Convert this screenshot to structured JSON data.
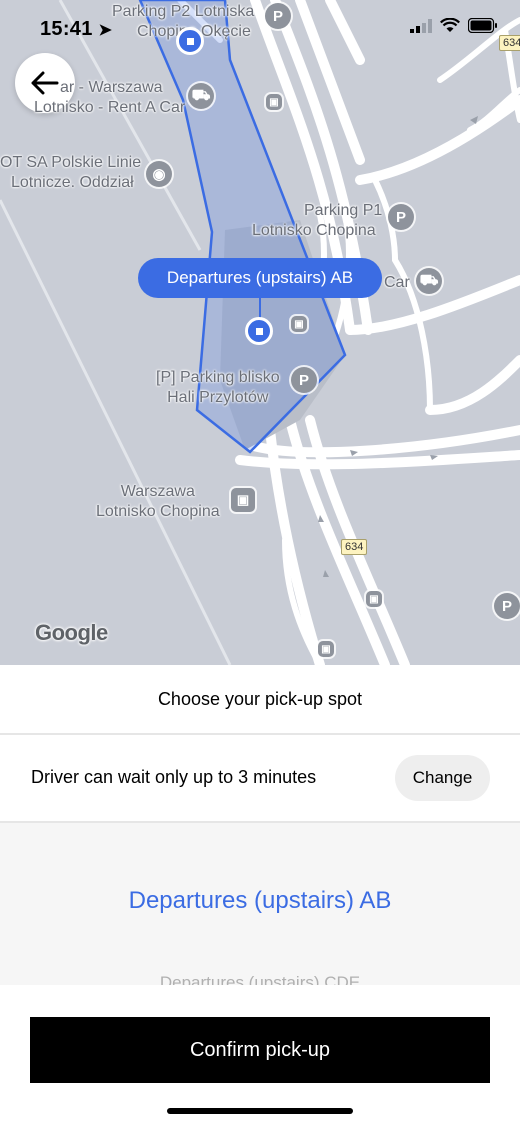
{
  "status_bar": {
    "time": "15:41",
    "location_icon": "location-arrow-icon",
    "signal_icon": "cellular-signal-icon",
    "wifi_icon": "wifi-icon",
    "battery_icon": "battery-icon"
  },
  "map": {
    "back_icon": "arrow-left-icon",
    "pickup_pin_label": "Departures (upstairs) AB",
    "labels": {
      "parking_p2_line1": "Parking P2 Lotniska",
      "parking_p2_line2": "Chopina Okęcie",
      "rent_line1": "ar - Warszawa",
      "rent_line2": "Lotnisko - Rent A Car",
      "lot_line1": "OT SA Polskie Linie",
      "lot_line2": "Lotnicze. Oddział",
      "parking_p1_line1": "Parking P1",
      "parking_p1_line2": "Lotnisko Chopina",
      "car": "Car",
      "parking_hali_line1": "[P] Parking blisko",
      "parking_hali_line2": "Hali Przylotów",
      "station_line1": "Warszawa",
      "station_line2": "Lotnisko Chopina",
      "google": "Google"
    },
    "road_shields": [
      "634",
      "634"
    ],
    "poi_glyphs": {
      "parking": "P",
      "bus": "▣",
      "camera": "◉",
      "car": "⛟"
    },
    "accent_color": "#3b6ce3"
  },
  "sheet": {
    "title": "Choose your pick-up spot",
    "wait_text": "Driver can wait only up to 3 minutes",
    "change_label": "Change",
    "selected_spot": "Departures (upstairs) AB",
    "next_spot": "Departures (upstairs) CDE",
    "confirm_label": "Confirm pick-up"
  }
}
